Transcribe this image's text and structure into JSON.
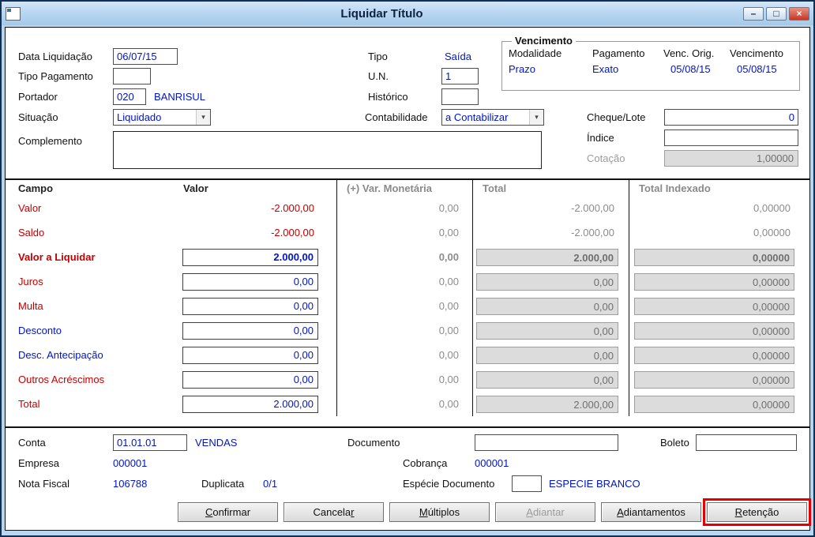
{
  "window": {
    "title": "Liquidar Título",
    "controls": {
      "minimize": "–",
      "maximize": "□",
      "close": "×"
    }
  },
  "top": {
    "data_liquidacao_label": "Data Liquidação",
    "data_liquidacao_value": "06/07/15",
    "tipo_pagamento_label": "Tipo Pagamento",
    "tipo_pagamento_value": "",
    "portador_label": "Portador",
    "portador_value": "020",
    "portador_name": "BANRISUL",
    "situacao_label": "Situação",
    "situacao_value": "Liquidado",
    "complemento_label": "Complemento",
    "complemento_value": "",
    "tipo_label": "Tipo",
    "tipo_value": "Saída",
    "un_label": "U.N.",
    "un_value": "1",
    "historico_label": "Histórico",
    "historico_value": "",
    "contabilidade_label": "Contabilidade",
    "contabilidade_value": "a Contabilizar",
    "cheque_lote_label": "Cheque/Lote",
    "cheque_lote_value": "0",
    "indice_label": "Índice",
    "indice_value": "",
    "cotacao_label": "Cotação",
    "cotacao_value": "1,00000"
  },
  "vencimento": {
    "title": "Vencimento",
    "modalidade_label": "Modalidade",
    "modalidade_value": "Prazo",
    "pagamento_label": "Pagamento",
    "pagamento_value": "Exato",
    "venc_orig_label": "Venc. Orig.",
    "venc_orig_value": "05/08/15",
    "vencimento_label": "Vencimento",
    "vencimento_value": "05/08/15"
  },
  "grid": {
    "headers": [
      "Campo",
      "Valor",
      "(+) Var. Monetária",
      "Total",
      "Total Indexado"
    ],
    "rows": [
      {
        "label": "Valor",
        "valor": "-2.000,00",
        "var": "0,00",
        "total": "-2.000,00",
        "indexado": "0,00000"
      },
      {
        "label": "Saldo",
        "valor": "-2.000,00",
        "var": "0,00",
        "total": "-2.000,00",
        "indexado": "0,00000"
      },
      {
        "label": "Valor a Liquidar",
        "valor": "2.000,00",
        "var": "0,00",
        "total": "2.000,00",
        "indexado": "0,00000"
      },
      {
        "label": "Juros",
        "valor": "0,00",
        "var": "0,00",
        "total": "0,00",
        "indexado": "0,00000"
      },
      {
        "label": "Multa",
        "valor": "0,00",
        "var": "0,00",
        "total": "0,00",
        "indexado": "0,00000"
      },
      {
        "label": "Desconto",
        "valor": "0,00",
        "var": "0,00",
        "total": "0,00",
        "indexado": "0,00000"
      },
      {
        "label": "Desc. Antecipação",
        "valor": "0,00",
        "var": "0,00",
        "total": "0,00",
        "indexado": "0,00000"
      },
      {
        "label": "Outros Acréscimos",
        "valor": "0,00",
        "var": "0,00",
        "total": "0,00",
        "indexado": "0,00000"
      },
      {
        "label": "Total",
        "valor": "2.000,00",
        "var": "0,00",
        "total": "2.000,00",
        "indexado": "0,00000"
      }
    ]
  },
  "bottom": {
    "conta_label": "Conta",
    "conta_value": "01.01.01",
    "conta_name": "VENDAS",
    "documento_label": "Documento",
    "documento_value": "",
    "boleto_label": "Boleto",
    "boleto_value": "",
    "empresa_label": "Empresa",
    "empresa_value": "000001",
    "cobranca_label": "Cobrança",
    "cobranca_value": "000001",
    "nota_fiscal_label": "Nota Fiscal",
    "nota_fiscal_value": "106788",
    "duplicata_label": "Duplicata",
    "duplicata_value": "0/1",
    "especie_label": "Espécie Documento",
    "especie_value": "",
    "especie_name": "ESPECIE BRANCO"
  },
  "buttons": [
    {
      "pre": "",
      "u": "C",
      "post": "onfirmar"
    },
    {
      "pre": "Cancela",
      "u": "r",
      "post": ""
    },
    {
      "pre": "",
      "u": "M",
      "post": "últiplos"
    },
    {
      "pre": "",
      "u": "A",
      "post": "diantar"
    },
    {
      "pre": "",
      "u": "A",
      "post": "diantamentos"
    },
    {
      "pre": "",
      "u": "R",
      "post": "etenção"
    }
  ],
  "colors": {
    "accent_blue": "#0014c8",
    "label_red": "#c40000",
    "highlight_red": "#e40000",
    "titlebar_blue": "#b4d4ef",
    "readonly_gray": "#dcdcdc"
  }
}
